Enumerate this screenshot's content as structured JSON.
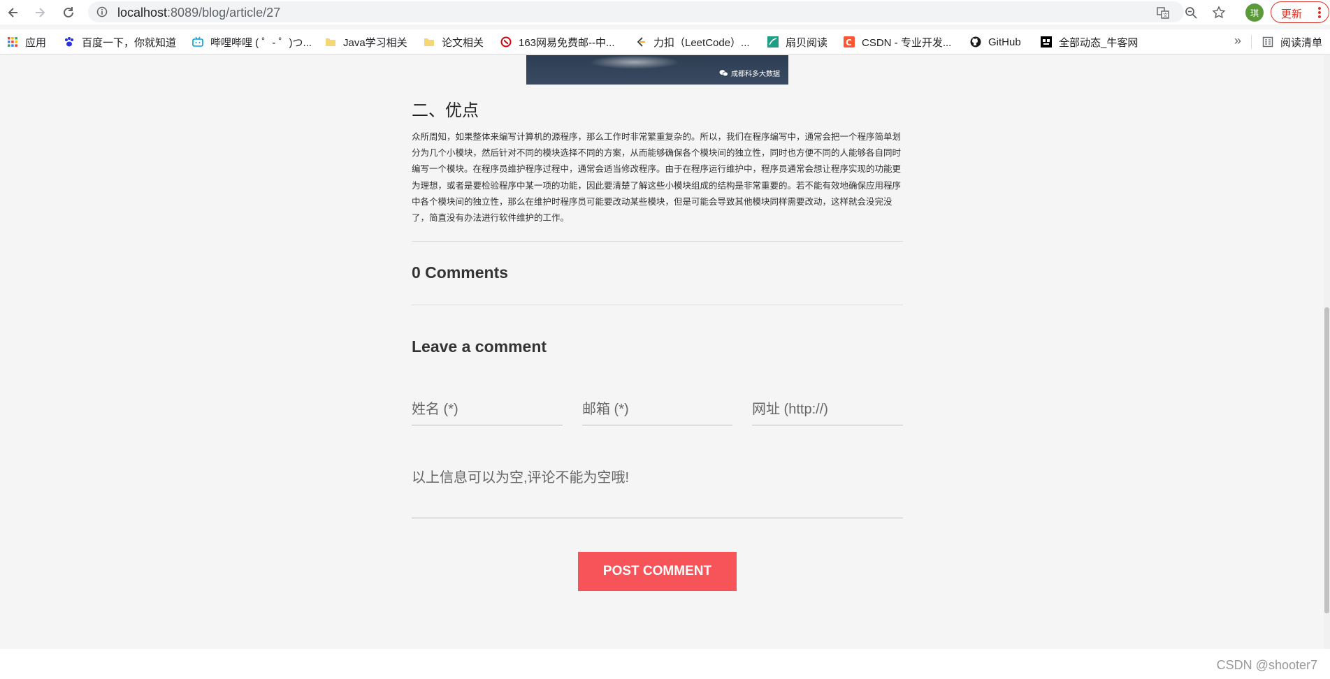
{
  "browser": {
    "url_host": "localhost",
    "url_path": ":8089/blog/article/27",
    "profile_initial": "琪",
    "update_label": "更新",
    "bookmarks": [
      {
        "label": "应用",
        "icon": "apps-grid-icon"
      },
      {
        "label": "百度一下，你就知道",
        "icon": "baidu-paw-icon"
      },
      {
        "label": "哔哩哔哩 ( ゜- ゜)つ...",
        "icon": "bilibili-tv-icon"
      },
      {
        "label": "Java学习相关",
        "icon": "folder-icon"
      },
      {
        "label": "论文相关",
        "icon": "folder-icon"
      },
      {
        "label": "163网易免费邮--中...",
        "icon": "netease-icon"
      },
      {
        "label": "力扣（LeetCode）...",
        "icon": "leetcode-icon"
      },
      {
        "label": "扇贝阅读",
        "icon": "shanbay-icon"
      },
      {
        "label": "CSDN - 专业开发...",
        "icon": "csdn-icon"
      },
      {
        "label": "GitHub",
        "icon": "github-icon"
      },
      {
        "label": "全部动态_牛客网",
        "icon": "nowcoder-icon"
      }
    ],
    "more_label": "»",
    "reading_list_label": "阅读清单"
  },
  "article": {
    "image_watermark": "成都科多大数据",
    "section_heading": "二、优点",
    "paragraph": "众所周知，如果整体来编写计算机的源程序，那么工作时非常繁重复杂的。所以，我们在程序编写中，通常会把一个程序简单划分为几个小模块，然后针对不同的模块选择不同的方案，从而能够确保各个模块间的独立性，同时也方便不同的人能够各自同时编写一个模块。在程序员维护程序过程中，通常会适当修改程序。由于在程序运行维护中，程序员通常会想让程序实现的功能更为理想，或者是要检验程序中某一项的功能，因此要清楚了解这些小模块组成的结构是非常重要的。若不能有效地确保应用程序中各个模块间的独立性，那么在维护时程序员可能要改动某些模块，但是可能会导致其他模块同样需要改动，这样就会没完没了，简直没有办法进行软件维护的工作。"
  },
  "comments": {
    "count_title": "0 Comments",
    "leave_title": "Leave a comment",
    "name_placeholder": "姓名 (*)",
    "email_placeholder": "邮箱 (*)",
    "url_placeholder": "网址 (http://)",
    "comment_placeholder": "以上信息可以为空,评论不能为空哦!",
    "post_label": "POST COMMENT"
  },
  "watermark": "CSDN @shooter7",
  "colors": {
    "accent": "#f7545a",
    "page_bg": "#f5f5f5"
  }
}
